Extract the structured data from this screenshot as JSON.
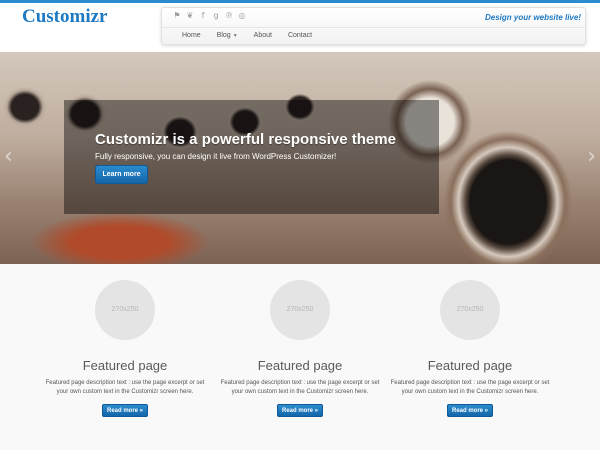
{
  "header": {
    "logo": "Customizr",
    "tagline": "Design your website live!",
    "social_icons": [
      "rss-icon",
      "twitter-icon",
      "facebook-icon",
      "google-plus-icon",
      "pinterest-icon",
      "dribbble-icon"
    ],
    "social_glyphs": [
      "⚑",
      "❦",
      "f",
      "g",
      "℗",
      "◎"
    ],
    "menu": [
      {
        "label": "Home"
      },
      {
        "label": "Blog"
      },
      {
        "label": "About"
      },
      {
        "label": "Contact"
      }
    ]
  },
  "slider": {
    "title": "Customizr is a powerful responsive theme",
    "text": "Fully responsive, you can design it live from WordPress Customizer!",
    "button": "Learn more",
    "prev": "‹",
    "next": "›"
  },
  "featured": [
    {
      "thumb": "270x250",
      "title": "Featured page",
      "desc": "Featured page description text : use the page excerpt or set your own custom text in the Customizr screen here.",
      "button": "Read more »"
    },
    {
      "thumb": "270x250",
      "title": "Featured page",
      "desc": "Featured page description text : use the page excerpt or set your own custom text in the Customizr screen here.",
      "button": "Read more »"
    },
    {
      "thumb": "270x250",
      "title": "Featured page",
      "desc": "Featured page description text : use the page excerpt or set your own custom text in the Customizr screen here.",
      "button": "Read more »"
    }
  ],
  "colors": {
    "accent": "#1e79c3",
    "button": "#2a8cce"
  }
}
